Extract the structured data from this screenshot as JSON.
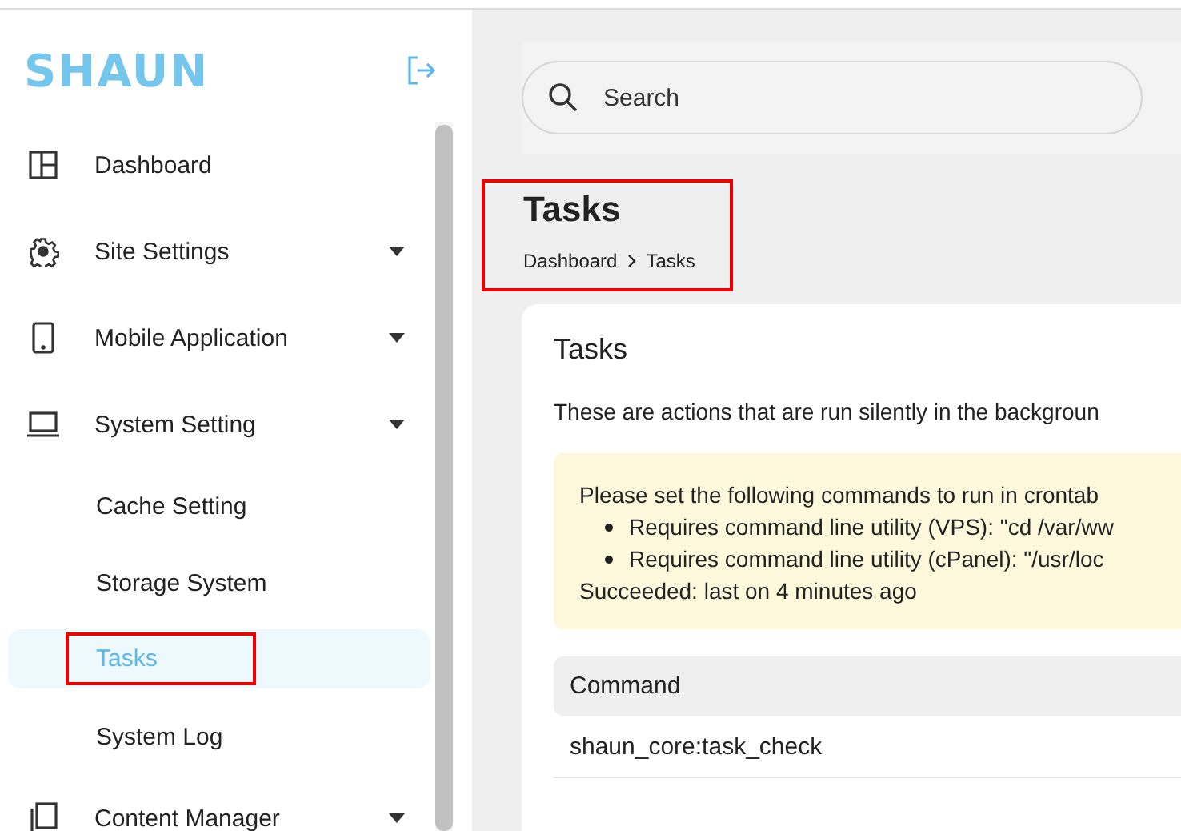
{
  "logo": "SHAUN",
  "sidebar": {
    "items": [
      {
        "label": "Dashboard",
        "expandable": false,
        "selected": false
      },
      {
        "label": "Site Settings",
        "expandable": true,
        "selected": false
      },
      {
        "label": "Mobile Application",
        "expandable": true,
        "selected": false
      },
      {
        "label": "System Setting",
        "expandable": true,
        "selected": false,
        "children": [
          {
            "label": "Cache Setting",
            "selected": false,
            "highlighted": false
          },
          {
            "label": "Storage System",
            "selected": false,
            "highlighted": false
          },
          {
            "label": "Tasks",
            "selected": true,
            "highlighted": true
          },
          {
            "label": "System Log",
            "selected": false,
            "highlighted": false
          }
        ]
      },
      {
        "label": "Content Manager",
        "expandable": true,
        "selected": false
      }
    ]
  },
  "search": {
    "placeholder": "Search"
  },
  "page_header": {
    "title": "Tasks",
    "highlighted": true,
    "breadcrumb": [
      "Dashboard",
      "Tasks"
    ]
  },
  "card": {
    "title": "Tasks",
    "description": "These are actions that are run silently in the backgroun",
    "alert": {
      "intro": "Please set the following commands to run in crontab",
      "items": [
        "Requires command line utility (VPS): \"cd /var/ww",
        "Requires command line utility (cPanel): \"/usr/loc"
      ],
      "status": "Succeeded: last on 4 minutes ago"
    },
    "table": {
      "columns": [
        "Command"
      ],
      "rows": [
        [
          "shaun_core:task_check"
        ]
      ]
    }
  }
}
